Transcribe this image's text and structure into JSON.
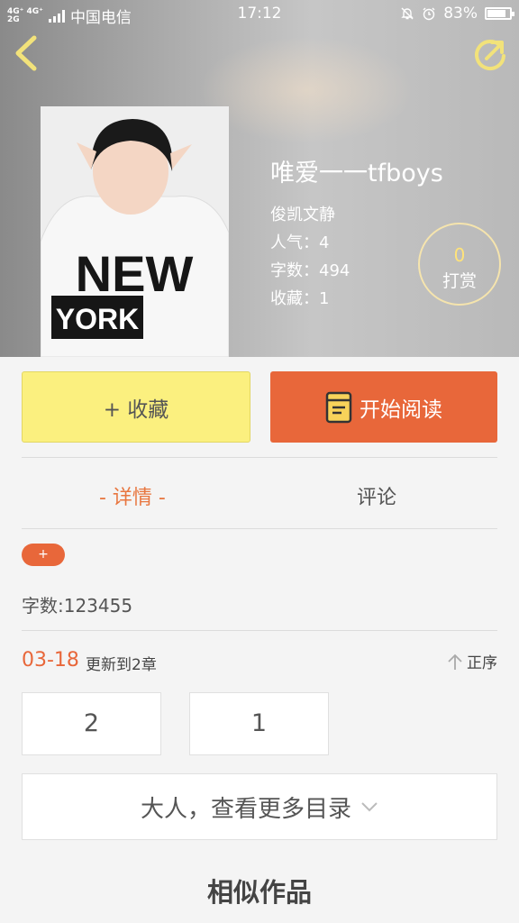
{
  "statusbar": {
    "network_top": "4G⁺ 4G⁺",
    "network_bottom": "2G",
    "carrier": "中国电信",
    "time": "17:12",
    "battery": "83%",
    "battery_level": 0.83
  },
  "book": {
    "title": "唯爱一一tfboys",
    "author": "俊凯文静",
    "popularity": "人气：4",
    "words": "字数：494",
    "favorites": "收藏：1",
    "cover_text_line1": "NEW",
    "cover_text_line2": "YORK"
  },
  "tip": {
    "count": "0",
    "label": "打赏"
  },
  "actions": {
    "favorite": "+ 收藏",
    "read": "开始阅读"
  },
  "tabs": {
    "detail": "- 详情 -",
    "comment": "评论"
  },
  "detail": {
    "tag": "+",
    "word_count": "字数:123455"
  },
  "update": {
    "date": "03-18",
    "text": "更新到2章",
    "order": "正序"
  },
  "chapters": [
    "2",
    "1"
  ],
  "more_catalog": "大人，查看更多目录",
  "similar_title": "相似作品",
  "colors": {
    "accent": "#e8673a",
    "favorite_bg": "#fbf07f"
  }
}
